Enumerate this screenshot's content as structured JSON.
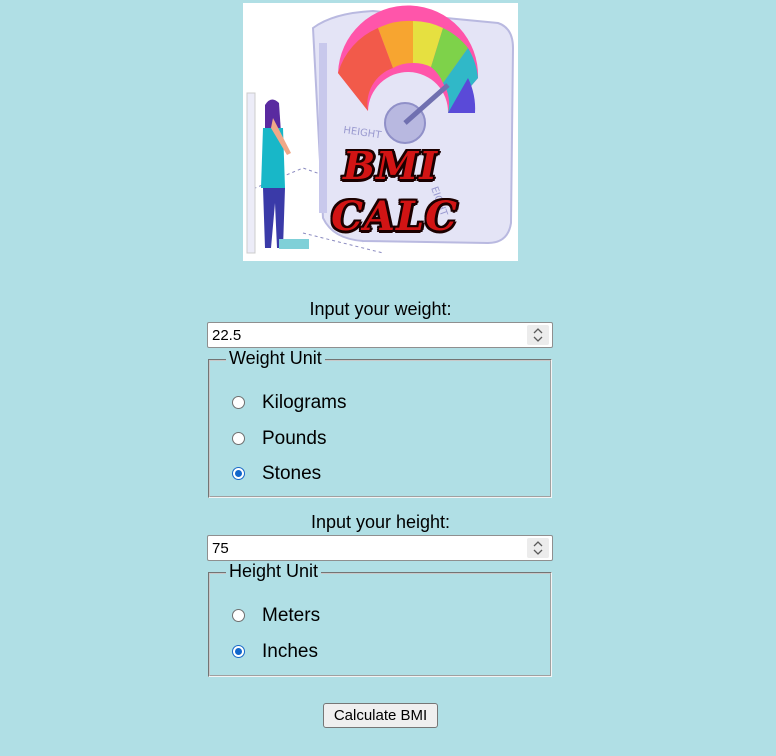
{
  "logo": {
    "line1": "BMI",
    "line2": "CALC",
    "ruler_label_left": "HEIGHT",
    "ruler_label_right": "EIGHT"
  },
  "weight": {
    "label": "Input your weight:",
    "value": "22.5",
    "unit_legend": "Weight Unit",
    "options": [
      {
        "label": "Kilograms",
        "checked": false
      },
      {
        "label": "Pounds",
        "checked": false
      },
      {
        "label": "Stones",
        "checked": true
      }
    ]
  },
  "height": {
    "label": "Input your height:",
    "value": "75",
    "unit_legend": "Height Unit",
    "options": [
      {
        "label": "Meters",
        "checked": false
      },
      {
        "label": "Inches",
        "checked": true
      }
    ]
  },
  "actions": {
    "calculate_label": "Calculate BMI"
  },
  "colors": {
    "page_background": "#b0dfe5",
    "radio_checked": "#1166cc",
    "logo_text": "#d21414"
  }
}
